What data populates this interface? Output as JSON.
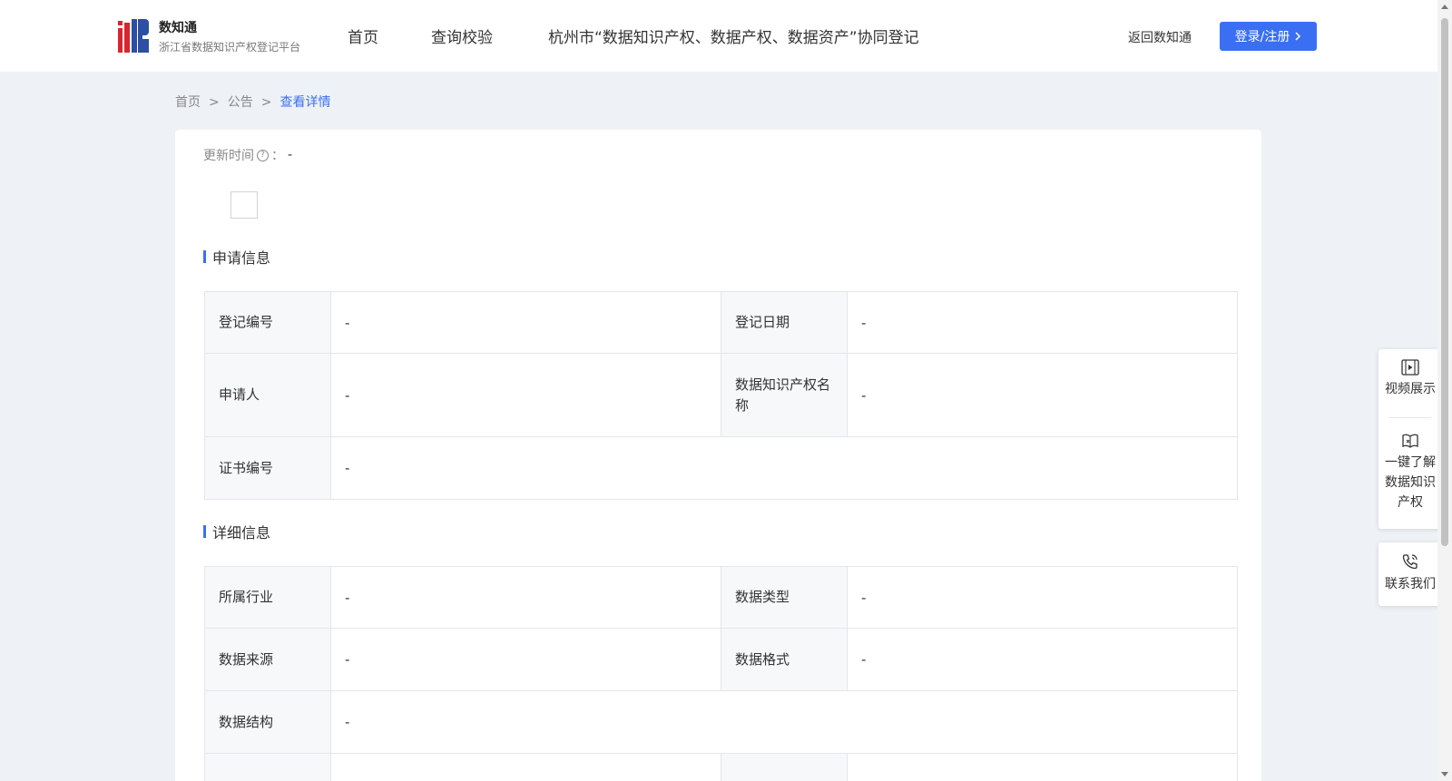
{
  "header": {
    "brand_name": "数知通",
    "brand_sub": "浙江省数据知识产权登记平台",
    "nav": [
      "首页",
      "查询校验",
      "杭州市“数据知识产权、数据产权、数据资产”协同登记"
    ],
    "back_label": "返回数知通",
    "login_label": "登录/注册",
    "login_icon": "chevron-right-icon",
    "accent_color": "#3a6ff4"
  },
  "breadcrumb": {
    "items": [
      "首页",
      "公告"
    ],
    "current": "查看详情",
    "separator": ">"
  },
  "update": {
    "label": "更新时间",
    "colon": "：",
    "value": "-"
  },
  "apply_section": {
    "title": "申请信息",
    "rows": [
      {
        "l1": "登记编号",
        "v1": "-",
        "l2": "登记日期",
        "v2": "-"
      },
      {
        "l1": "申请人",
        "v1": "-",
        "l2": "数据知识产权名称",
        "v2": "-"
      },
      {
        "l1": "证书编号",
        "v1": "-"
      }
    ]
  },
  "detail_section": {
    "title": "详细信息",
    "rows": [
      {
        "l1": "所属行业",
        "v1": "-",
        "l2": "数据类型",
        "v2": "-"
      },
      {
        "l1": "数据来源",
        "v1": "-",
        "l2": "数据格式",
        "v2": "-"
      },
      {
        "l1": "数据结构",
        "v1": "-"
      }
    ]
  },
  "float": {
    "video": "视频展示",
    "learn": [
      "一键了解",
      "数据知识",
      "产权"
    ],
    "contact": "联系我们"
  }
}
